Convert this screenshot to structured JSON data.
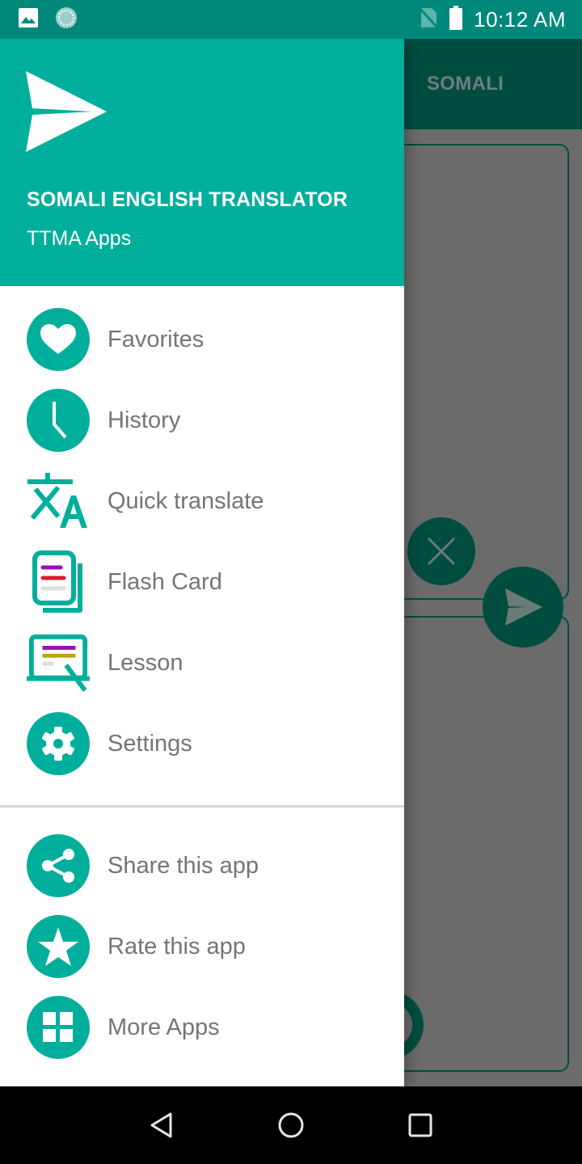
{
  "status_bar": {
    "time": "10:12 AM",
    "left_icons": [
      "image-notification-icon",
      "sync-notification-icon"
    ],
    "right_icons": [
      "no-sim-icon",
      "battery-full-icon"
    ]
  },
  "background_app": {
    "tab_label": "SOMALI",
    "buttons": [
      "clear-button",
      "translate-button",
      "mic-button"
    ]
  },
  "drawer": {
    "header": {
      "title": "SOMALI ENGLISH TRANSLATOR",
      "subtitle": "TTMA Apps",
      "logo_icon": "paper-plane-icon"
    },
    "primary_items": [
      {
        "label": "Favorites",
        "icon": "heart-icon"
      },
      {
        "label": "History",
        "icon": "clock-icon"
      },
      {
        "label": "Quick translate",
        "icon": "translate-icon"
      },
      {
        "label": "Flash Card",
        "icon": "flash-card-icon"
      },
      {
        "label": "Lesson",
        "icon": "lesson-icon"
      },
      {
        "label": "Settings",
        "icon": "gear-icon"
      }
    ],
    "secondary_items": [
      {
        "label": "Share this app",
        "icon": "share-icon"
      },
      {
        "label": "Rate this app",
        "icon": "star-icon"
      },
      {
        "label": "More Apps",
        "icon": "grid-icon"
      }
    ]
  },
  "colors": {
    "status_bar": "#00897b",
    "accent": "#00af9b",
    "toolbar_dimmed": "#004d40",
    "scrim": "#6b6b6b",
    "menu_text": "#757575"
  },
  "nav_bar": {
    "buttons": [
      "back",
      "home",
      "recents"
    ]
  }
}
